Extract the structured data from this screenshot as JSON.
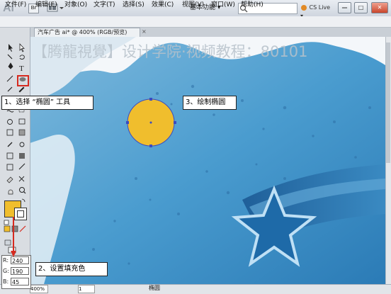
{
  "app": {
    "logo": "Ai",
    "bridge_label": "Br",
    "workspace_label": "基本功能 ▾",
    "cs_live": "CS Live ▾",
    "window_controls": [
      "—",
      "□",
      "✕"
    ]
  },
  "menu": [
    "文件(F)",
    "编辑(E)",
    "对象(O)",
    "文字(T)",
    "选择(S)",
    "效果(C)",
    "视图(V)",
    "窗口(W)",
    "帮助(H)"
  ],
  "document": {
    "tab_label": "汽车广告 ai* @ 400% (RGB/预览)",
    "tab_close": "×",
    "watermark": "【腾龍視覺】设计学院·视频教程：80101"
  },
  "callouts": {
    "step1": "1、选择 “椭圆” 工具",
    "step2": "2、设置填充色",
    "step3": "3、绘制椭圆"
  },
  "fill_color": {
    "r_label": "R:",
    "r": "240",
    "g_label": "G:",
    "g": "190",
    "b_label": "B:",
    "b": "45",
    "hex": "#f0be2d"
  },
  "status": {
    "zoom": "400%",
    "page": "1",
    "tool": "椭圆"
  },
  "colors": {
    "accent_red": "#d62a1f",
    "ellipse_fill": "#f0be2d",
    "ellipse_stroke": "#3b4cc0",
    "canvas_blue": "#4a93c6",
    "star_blue": "#2071b0"
  },
  "icons": {
    "selection": "selection-arrow-icon",
    "direct_selection": "direct-selection-icon",
    "pen": "pen-icon",
    "type": "type-icon",
    "line": "line-segment-icon",
    "ellipse": "ellipse-tool-icon"
  }
}
